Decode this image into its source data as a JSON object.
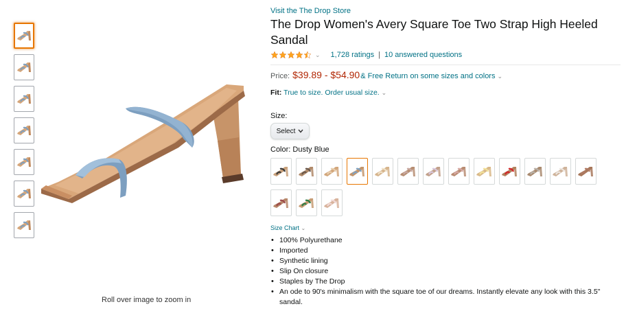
{
  "thumbnails": [
    {
      "name": "thumb-1",
      "selected": true
    },
    {
      "name": "thumb-2",
      "selected": false
    },
    {
      "name": "thumb-3",
      "selected": false
    },
    {
      "name": "thumb-4",
      "selected": false
    },
    {
      "name": "thumb-5",
      "selected": false
    },
    {
      "name": "thumb-6",
      "selected": false
    },
    {
      "name": "thumb-7",
      "selected": false
    }
  ],
  "image": {
    "zoom_hint": "Roll over image to zoom in"
  },
  "product": {
    "store_link": "Visit the The Drop Store",
    "title": "The Drop Women's Avery Square Toe Two Strap High Heeled Sandal",
    "rating_value": 4.5,
    "ratings_count": "1,728 ratings",
    "separator": "|",
    "answered_questions": "10 answered questions",
    "price_label": "Price:",
    "price_range": "$39.89 - $54.90",
    "free_return": "& Free Return on some sizes and colors",
    "fit_label": "Fit:",
    "fit_text": "True to size. Order usual size.",
    "size_label": "Size:",
    "size_select": "Select",
    "color_label": "Color:",
    "color_value": "Dusty Blue",
    "size_chart": "Size Chart",
    "bullets": [
      "100% Polyurethane",
      "Imported",
      "Synthetic lining",
      "Slip On closure",
      "Staples by The Drop",
      "An ode to 90's minimalism with the square toe of our dreams. Instantly elevate any look with this 3.5\" sandal."
    ]
  },
  "colors": {
    "link": "#007185",
    "price": "#b12704",
    "star": "#ffa41c",
    "selected_border": "#e77600"
  },
  "swatches": [
    {
      "strap": "#3a3a3a",
      "sole": "#c8a07a"
    },
    {
      "strap": "#6b5a4e",
      "sole": "#b08a6a"
    },
    {
      "strap": "#e8cfb0",
      "sole": "#d2a77c"
    },
    {
      "strap": "#7fa2c2",
      "sole": "#c4956b",
      "selected": true
    },
    {
      "strap": "#f0e2c9",
      "sole": "#d6b48c"
    },
    {
      "strap": "#c9a9a2",
      "sole": "#b78e73"
    },
    {
      "strap": "#d8c7dc",
      "sole": "#c2a08a"
    },
    {
      "strap": "#d7a9a4",
      "sole": "#b98c72"
    },
    {
      "strap": "#f2e29a",
      "sole": "#d9b98a"
    },
    {
      "strap": "#d4262b",
      "sole": "#b1825e"
    },
    {
      "strap": "#b9b1a8",
      "sole": "#a98a6f"
    },
    {
      "strap": "#ece6e0",
      "sole": "#cfb39a"
    },
    {
      "strap": "#b07a64",
      "sole": "#a7775a"
    },
    {
      "strap": "#9c4a4a",
      "sole": "#b7876a"
    },
    {
      "strap": "#2e7d45",
      "sole": "#c79c74"
    },
    {
      "strap": "#f1d9d6",
      "sole": "#d8b39c"
    }
  ]
}
